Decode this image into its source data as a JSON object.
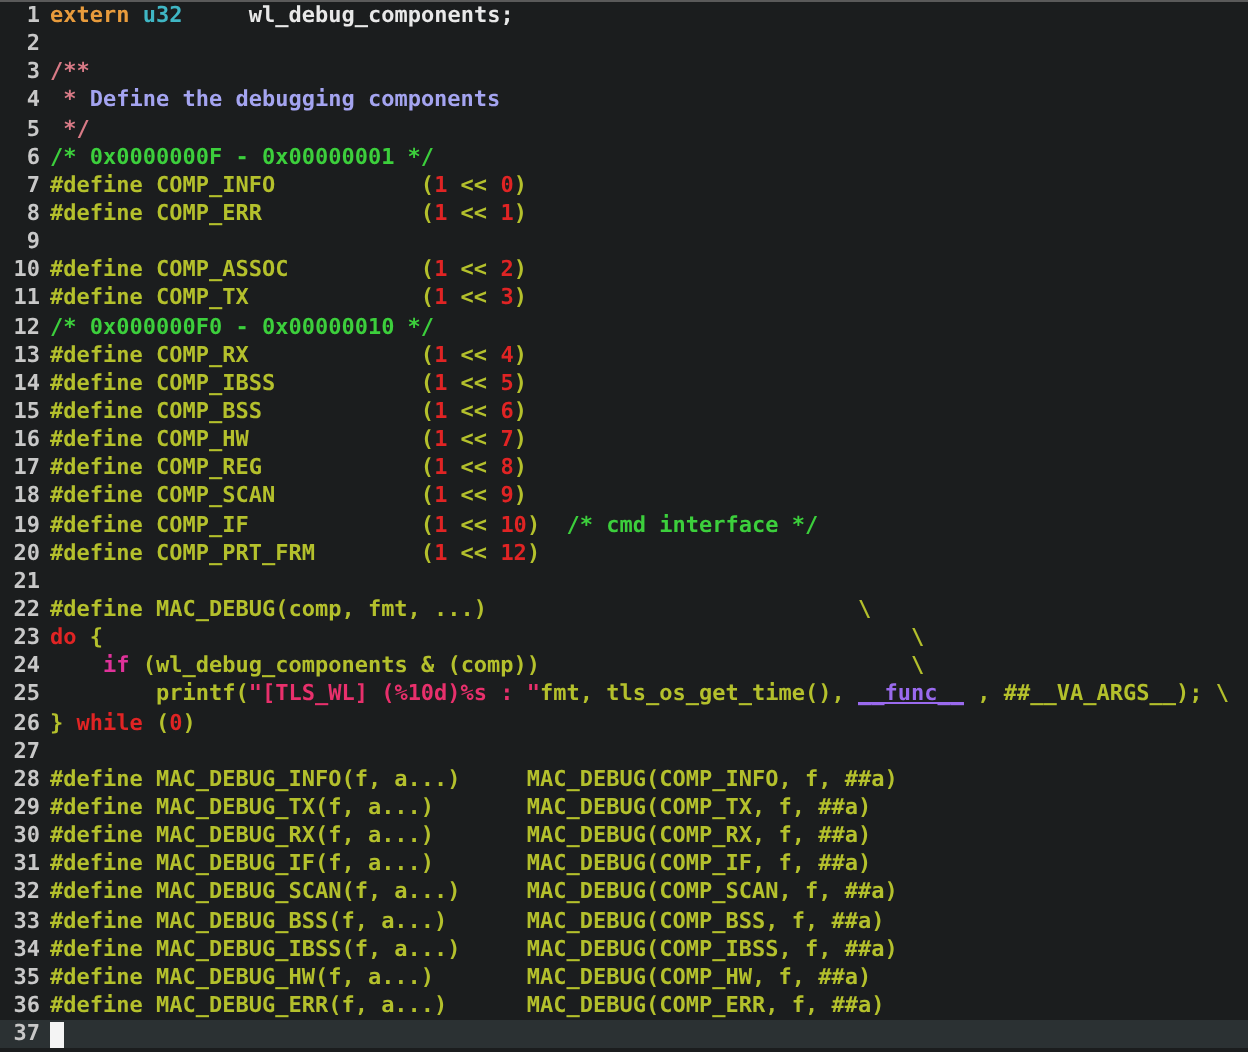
{
  "editor": {
    "lines": [
      {
        "number": "1",
        "current": false,
        "tokens": [
          {
            "text": "extern",
            "kind": "keyword"
          },
          {
            "text": " u32",
            "kind": "type"
          },
          {
            "text": "     wl_debug_components;",
            "kind": "plain"
          }
        ]
      },
      {
        "number": "2",
        "current": false
      },
      {
        "number": "3",
        "current": false,
        "tokens": [
          {
            "text": "/**",
            "kind": "docmark"
          }
        ]
      },
      {
        "number": "4",
        "current": false,
        "tokens": [
          {
            "text": " * ",
            "kind": "docmark"
          },
          {
            "text": "Define the debugging components",
            "kind": "doc"
          }
        ]
      },
      {
        "number": "5",
        "current": false,
        "tokens": [
          {
            "text": " */",
            "kind": "docmark"
          }
        ]
      },
      {
        "number": "6",
        "current": false,
        "tokens": [
          {
            "text": "/* 0x0000000F - 0x00000001 */",
            "kind": "comment"
          }
        ]
      },
      {
        "number": "7",
        "current": false,
        "tokens": [
          {
            "text": "#define COMP_INFO           (",
            "kind": "preproc"
          },
          {
            "text": "1",
            "kind": "number"
          },
          {
            "text": " << ",
            "kind": "preproc"
          },
          {
            "text": "0",
            "kind": "number"
          },
          {
            "text": ")",
            "kind": "preproc"
          }
        ]
      },
      {
        "number": "8",
        "current": false,
        "tokens": [
          {
            "text": "#define COMP_ERR            (",
            "kind": "preproc"
          },
          {
            "text": "1",
            "kind": "number"
          },
          {
            "text": " << ",
            "kind": "preproc"
          },
          {
            "text": "1",
            "kind": "number"
          },
          {
            "text": ")",
            "kind": "preproc"
          }
        ]
      },
      {
        "number": "9",
        "current": false
      },
      {
        "number": "10",
        "current": false,
        "tokens": [
          {
            "text": "#define COMP_ASSOC          (",
            "kind": "preproc"
          },
          {
            "text": "1",
            "kind": "number"
          },
          {
            "text": " << ",
            "kind": "preproc"
          },
          {
            "text": "2",
            "kind": "number"
          },
          {
            "text": ")",
            "kind": "preproc"
          }
        ]
      },
      {
        "number": "11",
        "current": false,
        "tokens": [
          {
            "text": "#define COMP_TX             (",
            "kind": "preproc"
          },
          {
            "text": "1",
            "kind": "number"
          },
          {
            "text": " << ",
            "kind": "preproc"
          },
          {
            "text": "3",
            "kind": "number"
          },
          {
            "text": ")",
            "kind": "preproc"
          }
        ]
      },
      {
        "number": "12",
        "current": false,
        "tokens": [
          {
            "text": "/* 0x000000F0 - 0x00000010 */",
            "kind": "comment"
          }
        ]
      },
      {
        "number": "13",
        "current": false,
        "tokens": [
          {
            "text": "#define COMP_RX             (",
            "kind": "preproc"
          },
          {
            "text": "1",
            "kind": "number"
          },
          {
            "text": " << ",
            "kind": "preproc"
          },
          {
            "text": "4",
            "kind": "number"
          },
          {
            "text": ")",
            "kind": "preproc"
          }
        ]
      },
      {
        "number": "14",
        "current": false,
        "tokens": [
          {
            "text": "#define COMP_IBSS           (",
            "kind": "preproc"
          },
          {
            "text": "1",
            "kind": "number"
          },
          {
            "text": " << ",
            "kind": "preproc"
          },
          {
            "text": "5",
            "kind": "number"
          },
          {
            "text": ")",
            "kind": "preproc"
          }
        ]
      },
      {
        "number": "15",
        "current": false,
        "tokens": [
          {
            "text": "#define COMP_BSS            (",
            "kind": "preproc"
          },
          {
            "text": "1",
            "kind": "number"
          },
          {
            "text": " << ",
            "kind": "preproc"
          },
          {
            "text": "6",
            "kind": "number"
          },
          {
            "text": ")",
            "kind": "preproc"
          }
        ]
      },
      {
        "number": "16",
        "current": false,
        "tokens": [
          {
            "text": "#define COMP_HW             (",
            "kind": "preproc"
          },
          {
            "text": "1",
            "kind": "number"
          },
          {
            "text": " << ",
            "kind": "preproc"
          },
          {
            "text": "7",
            "kind": "number"
          },
          {
            "text": ")",
            "kind": "preproc"
          }
        ]
      },
      {
        "number": "17",
        "current": false,
        "tokens": [
          {
            "text": "#define COMP_REG            (",
            "kind": "preproc"
          },
          {
            "text": "1",
            "kind": "number"
          },
          {
            "text": " << ",
            "kind": "preproc"
          },
          {
            "text": "8",
            "kind": "number"
          },
          {
            "text": ")",
            "kind": "preproc"
          }
        ]
      },
      {
        "number": "18",
        "current": false,
        "tokens": [
          {
            "text": "#define COMP_SCAN           (",
            "kind": "preproc"
          },
          {
            "text": "1",
            "kind": "number"
          },
          {
            "text": " << ",
            "kind": "preproc"
          },
          {
            "text": "9",
            "kind": "number"
          },
          {
            "text": ")",
            "kind": "preproc"
          }
        ]
      },
      {
        "number": "19",
        "current": false,
        "tokens": [
          {
            "text": "#define COMP_IF             (",
            "kind": "preproc"
          },
          {
            "text": "1",
            "kind": "number"
          },
          {
            "text": " << ",
            "kind": "preproc"
          },
          {
            "text": "10",
            "kind": "number"
          },
          {
            "text": ")",
            "kind": "preproc"
          },
          {
            "text": "  /* cmd interface */",
            "kind": "comment"
          }
        ]
      },
      {
        "number": "20",
        "current": false,
        "tokens": [
          {
            "text": "#define COMP_PRT_FRM        (",
            "kind": "preproc"
          },
          {
            "text": "1",
            "kind": "number"
          },
          {
            "text": " << ",
            "kind": "preproc"
          },
          {
            "text": "12",
            "kind": "number"
          },
          {
            "text": ")",
            "kind": "preproc"
          }
        ]
      },
      {
        "number": "21",
        "current": false
      },
      {
        "number": "22",
        "current": false,
        "tokens": [
          {
            "text": "#define MAC_DEBUG(comp, fmt, ...)                            \\",
            "kind": "preproc"
          }
        ]
      },
      {
        "number": "23",
        "current": false,
        "tokens": [
          {
            "text": "do",
            "kind": "statement"
          },
          {
            "text": " {                                                             \\",
            "kind": "preproc"
          }
        ]
      },
      {
        "number": "24",
        "current": false,
        "tokens": [
          {
            "text": "    if",
            "kind": "control"
          },
          {
            "text": " (wl_debug_components & (comp))                            \\",
            "kind": "preproc"
          }
        ]
      },
      {
        "number": "25",
        "current": false,
        "tokens": [
          {
            "text": "        printf(",
            "kind": "preproc"
          },
          {
            "text": "\"[TLS_WL] (%10d)%s : \"",
            "kind": "string"
          },
          {
            "text": "fmt, tls_os_get_time(), ",
            "kind": "preproc"
          },
          {
            "text": "__func__",
            "kind": "special"
          },
          {
            "text": " , ##__VA_ARGS__); \\",
            "kind": "preproc"
          }
        ]
      },
      {
        "number": "26",
        "current": false,
        "tokens": [
          {
            "text": "} ",
            "kind": "preproc"
          },
          {
            "text": "while",
            "kind": "statement"
          },
          {
            "text": " (",
            "kind": "preproc"
          },
          {
            "text": "0",
            "kind": "number"
          },
          {
            "text": ")",
            "kind": "preproc"
          }
        ]
      },
      {
        "number": "27",
        "current": false
      },
      {
        "number": "28",
        "current": false,
        "tokens": [
          {
            "text": "#define MAC_DEBUG_INFO(f, a...)     MAC_DEBUG(COMP_INFO, f, ##a)",
            "kind": "preproc"
          }
        ]
      },
      {
        "number": "29",
        "current": false,
        "tokens": [
          {
            "text": "#define MAC_DEBUG_TX(f, a...)       MAC_DEBUG(COMP_TX, f, ##a)",
            "kind": "preproc"
          }
        ]
      },
      {
        "number": "30",
        "current": false,
        "tokens": [
          {
            "text": "#define MAC_DEBUG_RX(f, a...)       MAC_DEBUG(COMP_RX, f, ##a)",
            "kind": "preproc"
          }
        ]
      },
      {
        "number": "31",
        "current": false,
        "tokens": [
          {
            "text": "#define MAC_DEBUG_IF(f, a...)       MAC_DEBUG(COMP_IF, f, ##a)",
            "kind": "preproc"
          }
        ]
      },
      {
        "number": "32",
        "current": false,
        "tokens": [
          {
            "text": "#define MAC_DEBUG_SCAN(f, a...)     MAC_DEBUG(COMP_SCAN, f, ##a)",
            "kind": "preproc"
          }
        ]
      },
      {
        "number": "33",
        "current": false,
        "tokens": [
          {
            "text": "#define MAC_DEBUG_BSS(f, a...)      MAC_DEBUG(COMP_BSS, f, ##a)",
            "kind": "preproc"
          }
        ]
      },
      {
        "number": "34",
        "current": false,
        "tokens": [
          {
            "text": "#define MAC_DEBUG_IBSS(f, a...)     MAC_DEBUG(COMP_IBSS, f, ##a)",
            "kind": "preproc"
          }
        ]
      },
      {
        "number": "35",
        "current": false,
        "tokens": [
          {
            "text": "#define MAC_DEBUG_HW(f, a...)       MAC_DEBUG(COMP_HW, f, ##a)",
            "kind": "preproc"
          }
        ]
      },
      {
        "number": "36",
        "current": false,
        "tokens": [
          {
            "text": "#define MAC_DEBUG_ERR(f, a...)      MAC_DEBUG(COMP_ERR, f, ##a)",
            "kind": "preproc"
          }
        ]
      },
      {
        "number": "37",
        "current": true
      }
    ]
  }
}
